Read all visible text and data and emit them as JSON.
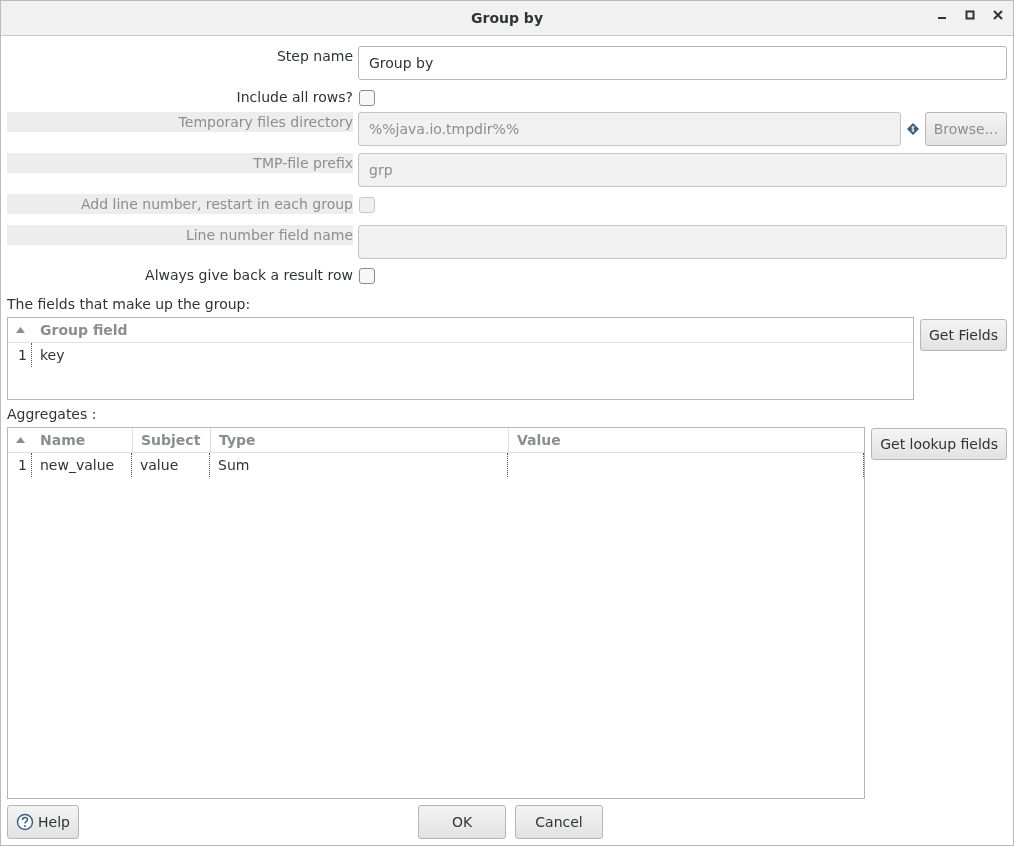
{
  "window": {
    "title": "Group by"
  },
  "form": [
    {
      "kind": "text",
      "label": "Step name",
      "value": "Group by",
      "disabled": false
    },
    {
      "kind": "checkbox",
      "label": "Include all rows?",
      "checked": false,
      "disabled": false
    },
    {
      "kind": "text",
      "label": "Temporary files directory",
      "value": "%%java.io.tmpdir%%",
      "disabled": true,
      "button": "Browse..."
    },
    {
      "kind": "text",
      "label": "TMP-file prefix",
      "value": "grp",
      "disabled": true
    },
    {
      "kind": "checkbox",
      "label": "Add line number, restart in each group",
      "checked": false,
      "disabled": true
    },
    {
      "kind": "text",
      "label": "Line number field name",
      "disabled": true
    },
    {
      "kind": "checkbox",
      "label": "Always give back a result row",
      "checked": false,
      "disabled": false
    }
  ],
  "group": {
    "title": "The fields that make up the group:",
    "columns": [
      "Group field"
    ],
    "rows": [
      {
        "number": "1",
        "cells": [
          "key"
        ]
      }
    ],
    "button": "Get Fields"
  },
  "aggregates": {
    "title": "Aggregates :",
    "columns": [
      "Name",
      "Subject",
      "Type",
      "Value"
    ],
    "rows": [
      {
        "number": "1",
        "cells": [
          "new_value",
          "value",
          "Sum",
          ""
        ]
      }
    ],
    "button": "Get lookup fields"
  },
  "buttons": {
    "help": "Help",
    "ok": "OK",
    "cancel": "Cancel"
  }
}
